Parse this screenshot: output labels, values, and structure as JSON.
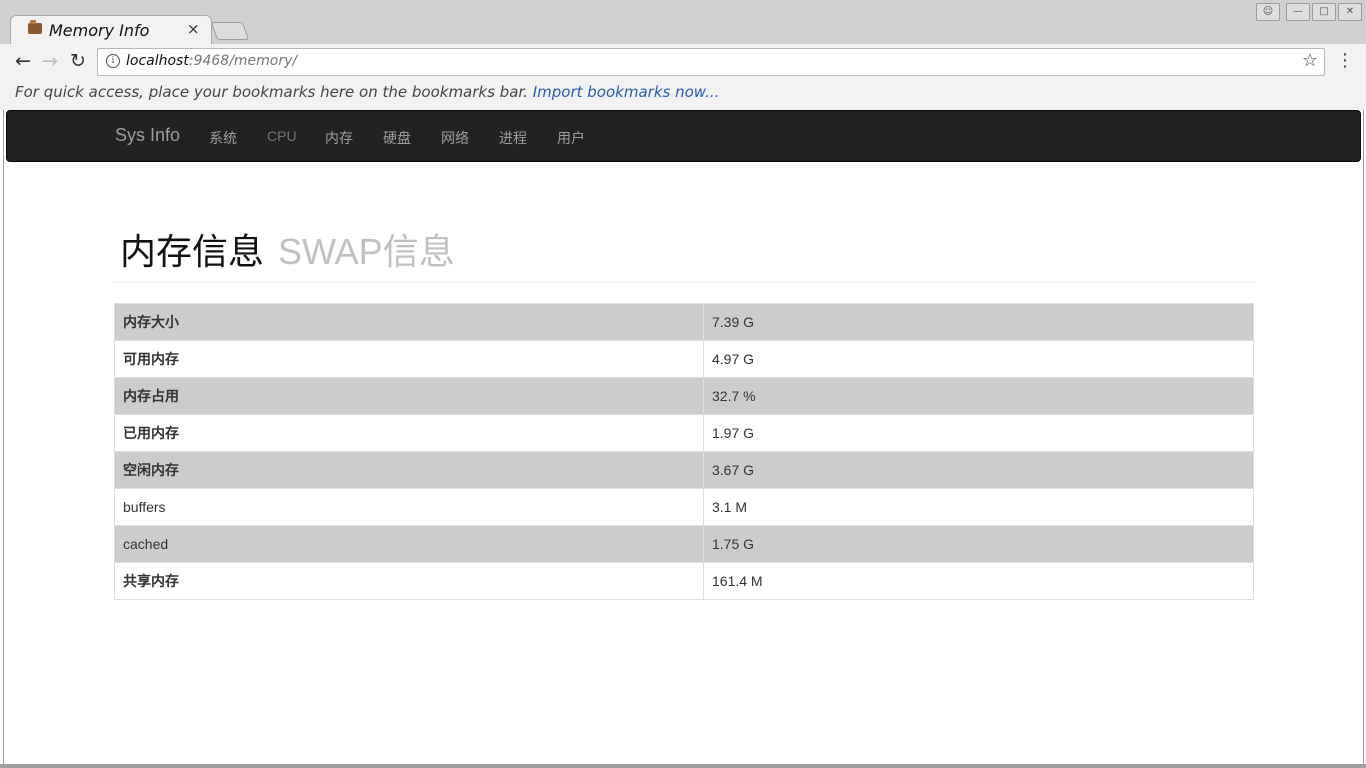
{
  "browser": {
    "tab_title": "Memory Info",
    "tab_close": "×",
    "url_host": "localhost",
    "url_rest": ":9468/memory/",
    "info_icon": "i",
    "star": "☆",
    "menu": "⋮",
    "back": "←",
    "forward": "→",
    "reload": "↻",
    "bookmark_msg": "For quick access, place your bookmarks here on the bookmarks bar.",
    "bookmark_link": "Import bookmarks now..."
  },
  "navbar": {
    "brand": "Sys Info",
    "links": [
      "系统",
      "CPU",
      "内存",
      "硬盘",
      "网络",
      "进程",
      "用户"
    ]
  },
  "heading": {
    "title": "内存信息",
    "subtitle": "SWAP信息"
  },
  "memory_rows": [
    {
      "key": "内存大小",
      "value": "7.39 G"
    },
    {
      "key": "可用内存",
      "value": "4.97 G"
    },
    {
      "key": "内存占用",
      "value": "32.7 %"
    },
    {
      "key": "已用内存",
      "value": "1.97 G"
    },
    {
      "key": "空闲内存",
      "value": "3.67 G"
    },
    {
      "key": "buffers",
      "value": "3.1 M"
    },
    {
      "key": "cached",
      "value": "1.75 G"
    },
    {
      "key": "共享内存",
      "value": "161.4 M"
    }
  ]
}
